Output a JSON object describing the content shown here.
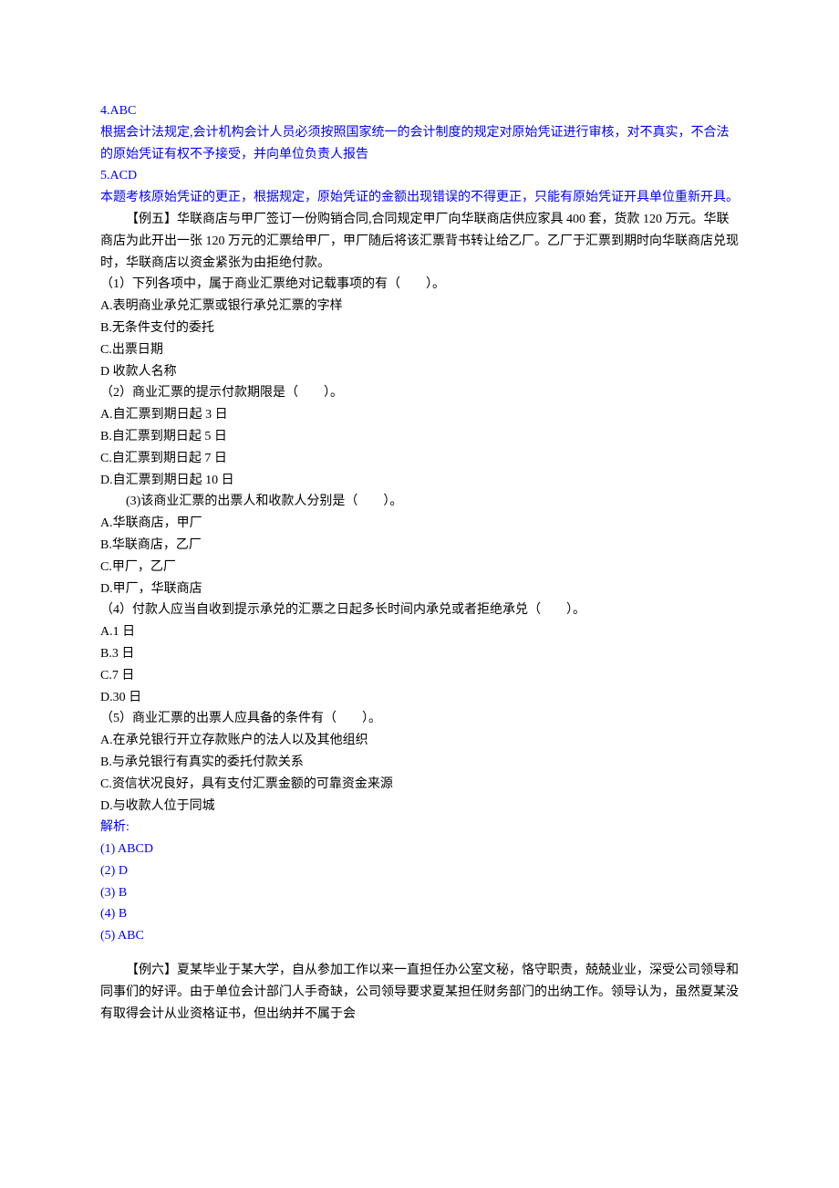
{
  "ans4": {
    "code": "4.ABC",
    "explain1": "根据会计法规定,会计机构会计人员必须按照国家统一的会计制度的规定对原始凭证进行审核，对不真实，不合法的原始凭证有权不予接受，并向单位负责人报告"
  },
  "ans5": {
    "code": "5.ACD",
    "explain1": "本题考核原始凭证的更正，根据规定，原始凭证的金额出现错误的不得更正，只能有原始凭证开具单位重新开具。"
  },
  "ex5": {
    "intro": "【例五】华联商店与甲厂签订一份购销合同,合同规定甲厂向华联商店供应家具 400 套，货款 120 万元。华联商店为此开出一张 120 万元的汇票给甲厂，甲厂随后将该汇票背书转让给乙厂。乙厂于汇票到期时向华联商店兑现时，华联商店以资金紧张为由拒绝付款。",
    "q1": {
      "stem": "（1）下列各项中，属于商业汇票绝对记载事项的有（　　）。",
      "A": "A.表明商业承兑汇票或银行承兑汇票的字样",
      "B": "B.无条件支付的委托",
      "C": "C.出票日期",
      "D": "D 收款人名称"
    },
    "q2": {
      "stem": "（2）商业汇票的提示付款期限是（　　）。",
      "A": "A.自汇票到期日起 3 日",
      "B": "B.自汇票到期日起 5 日",
      "C": "C.自汇票到期日起 7 日",
      "D": "D.自汇票到期日起 10 日"
    },
    "q3": {
      "stem": "　　(3)该商业汇票的出票人和收款人分别是（　　）。",
      "A": "A.华联商店，甲厂",
      "B": "B.华联商店，乙厂",
      "C": "C.甲厂，乙厂",
      "D": "D.甲厂，华联商店"
    },
    "q4": {
      "stem": "（4）付款人应当自收到提示承兑的汇票之日起多长时间内承兑或者拒绝承兑（　　）。",
      "A": "A.1 日",
      "B": "B.3 日",
      "C": "C.7 日",
      "D": "D.30 日"
    },
    "q5": {
      "stem": "（5）商业汇票的出票人应具备的条件有（　　）。",
      "A": "A.在承兑银行开立存款账户的法人以及其他组织",
      "B": "B.与承兑银行有真实的委托付款关系",
      "C": "C.资信状况良好，具有支付汇票金额的可靠资金来源",
      "D": "D.与收款人位于同城"
    },
    "answers": {
      "label": "解析:",
      "a1": "(1) ABCD",
      "a2": "(2) D",
      "a3": "(3) B",
      "a4": "(4) B",
      "a5": "(5) ABC"
    }
  },
  "ex6": {
    "intro": "【例六】夏某毕业于某大学，自从参加工作以来一直担任办公室文秘，恪守职责，兢兢业业，深受公司领导和同事们的好评。由于单位会计部门人手奇缺，公司领导要求夏某担任财务部门的出纳工作。领导认为，虽然夏某没有取得会计从业资格证书，但出纳并不属于会"
  }
}
